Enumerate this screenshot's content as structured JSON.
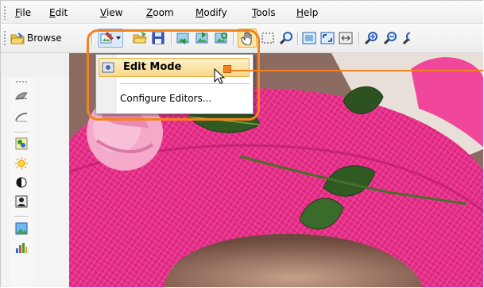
{
  "menubar": {
    "items": [
      {
        "label": "File",
        "mnemonic": "F"
      },
      {
        "label": "Edit",
        "mnemonic": "E"
      },
      {
        "label": "View",
        "mnemonic": "V"
      },
      {
        "label": "Zoom",
        "mnemonic": "Z"
      },
      {
        "label": "Modify",
        "mnemonic": "M"
      },
      {
        "label": "Tools",
        "mnemonic": "T"
      },
      {
        "label": "Help",
        "mnemonic": "H"
      }
    ]
  },
  "toolbar": {
    "browse_label": "Browse"
  },
  "dropdown": {
    "items": [
      {
        "label": "Edit Mode",
        "highlighted": true
      },
      {
        "label": "Configure Editors..."
      }
    ]
  },
  "colors": {
    "callout": "#f58220",
    "highlight": "#f7d88a",
    "hat": "#e8308a"
  }
}
